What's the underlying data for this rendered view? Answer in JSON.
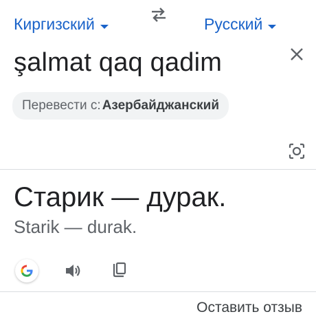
{
  "language_bar": {
    "source_lang": "Киргизский",
    "target_lang": "Русский",
    "swap_icon": "swap-arrows-icon"
  },
  "source": {
    "text": "şalmat qaq qadim",
    "detected_prefix": "Перевести с:",
    "detected_lang": "Азербайджанский",
    "clear_icon": "close-icon",
    "camera_icon": "camera-search-icon"
  },
  "result": {
    "translation": "Старик — дурак.",
    "transliteration": "Starik — durak.",
    "actions": [
      "google-logo-icon",
      "speaker-icon",
      "copy-icon"
    ]
  },
  "footer": {
    "feedback_label": "Оставить отзыв"
  },
  "colors": {
    "accent": "#1a63c9",
    "text_primary": "#202124",
    "text_secondary": "#5f6368",
    "chip_bg": "#f1f3f4",
    "divider": "#dadce0"
  }
}
